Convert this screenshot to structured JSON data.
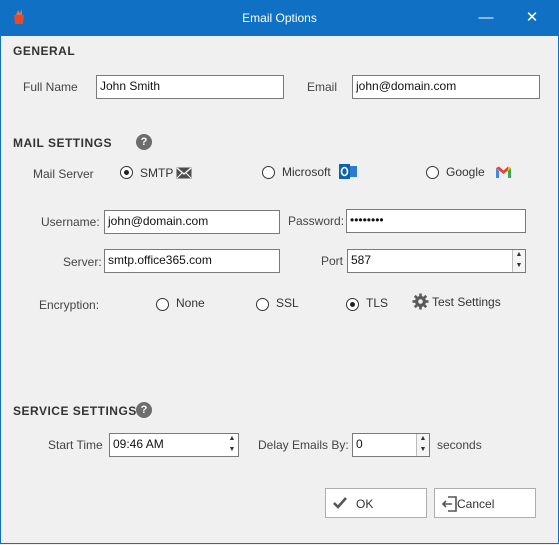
{
  "window": {
    "title": "Email Options",
    "minimize": "—",
    "close": "✕"
  },
  "general": {
    "section_title": "GENERAL",
    "full_name_label": "Full Name",
    "full_name_value": "John Smith",
    "email_label": "Email",
    "email_value": "john@domain.com"
  },
  "mail_settings": {
    "section_title": "MAIL SETTINGS",
    "help": "?",
    "mail_server_label": "Mail Server",
    "options": [
      {
        "label": "SMTP",
        "selected": true,
        "icon": "envelope-icon"
      },
      {
        "label": "Microsoft",
        "selected": false,
        "icon": "outlook-icon"
      },
      {
        "label": "Google",
        "selected": false,
        "icon": "gmail-icon"
      }
    ],
    "username_label": "Username:",
    "username_value": "john@domain.com",
    "password_label": "Password:",
    "password_value": "••••••••",
    "server_label": "Server:",
    "server_value": "smtp.office365.com",
    "port_label": "Port",
    "port_value": "587",
    "encryption_label": "Encryption:",
    "encryption_options": [
      {
        "label": "None",
        "selected": false
      },
      {
        "label": "SSL",
        "selected": false
      },
      {
        "label": "TLS",
        "selected": true
      }
    ],
    "test_settings_label": "Test Settings"
  },
  "service_settings": {
    "section_title": "SERVICE SETTINGS",
    "help": "?",
    "start_time_label": "Start Time",
    "start_time_value": "09:46 AM",
    "delay_label": "Delay Emails By:",
    "delay_value": "0",
    "delay_unit": "seconds"
  },
  "buttons": {
    "ok_label": "OK",
    "cancel_label": "Cancel"
  },
  "colors": {
    "titlebar": "#1070c4",
    "background": "#f0f0f0"
  }
}
